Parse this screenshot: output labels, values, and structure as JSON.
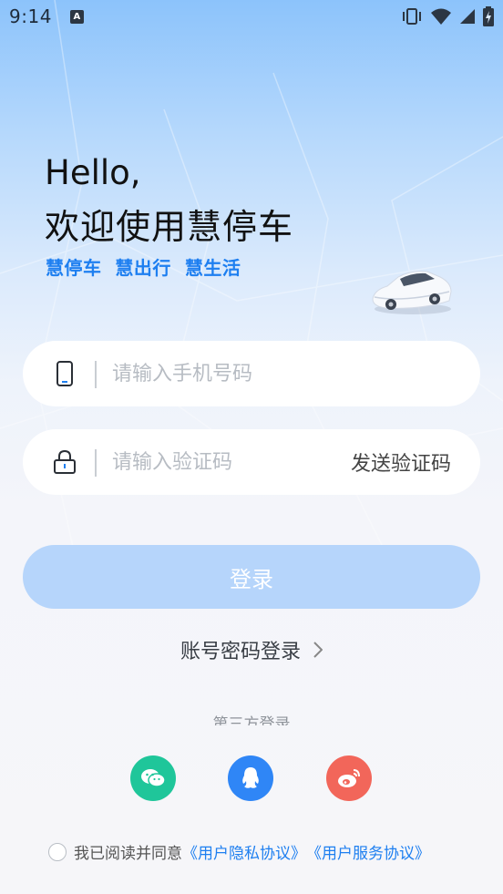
{
  "status_bar": {
    "time": "9:14",
    "notification_badge": "A"
  },
  "header": {
    "hello": "Hello,",
    "welcome": "欢迎使用慧停车",
    "slogan": "慧停车  慧出行  慧生活"
  },
  "phone_field": {
    "placeholder": "请输入手机号码",
    "icon": "phone-icon"
  },
  "code_field": {
    "placeholder": "请输入验证码",
    "icon": "lock-icon",
    "send_code_label": "发送验证码"
  },
  "login_button": {
    "label": "登录"
  },
  "password_login": {
    "label": "账号密码登录"
  },
  "third_party": {
    "title": "第三方登录",
    "providers": [
      {
        "name": "wechat",
        "color": "#1fc69a"
      },
      {
        "name": "qq",
        "color": "#2f86f6"
      },
      {
        "name": "weibo",
        "color": "#f2665a"
      }
    ]
  },
  "agreement": {
    "prefix": "我已阅读并同意",
    "privacy_link": "《用户隐私协议》",
    "service_link": "《用户服务协议》",
    "checked": false
  },
  "colors": {
    "accent": "#1e7ff0",
    "login_disabled": "#b6d5fb"
  }
}
